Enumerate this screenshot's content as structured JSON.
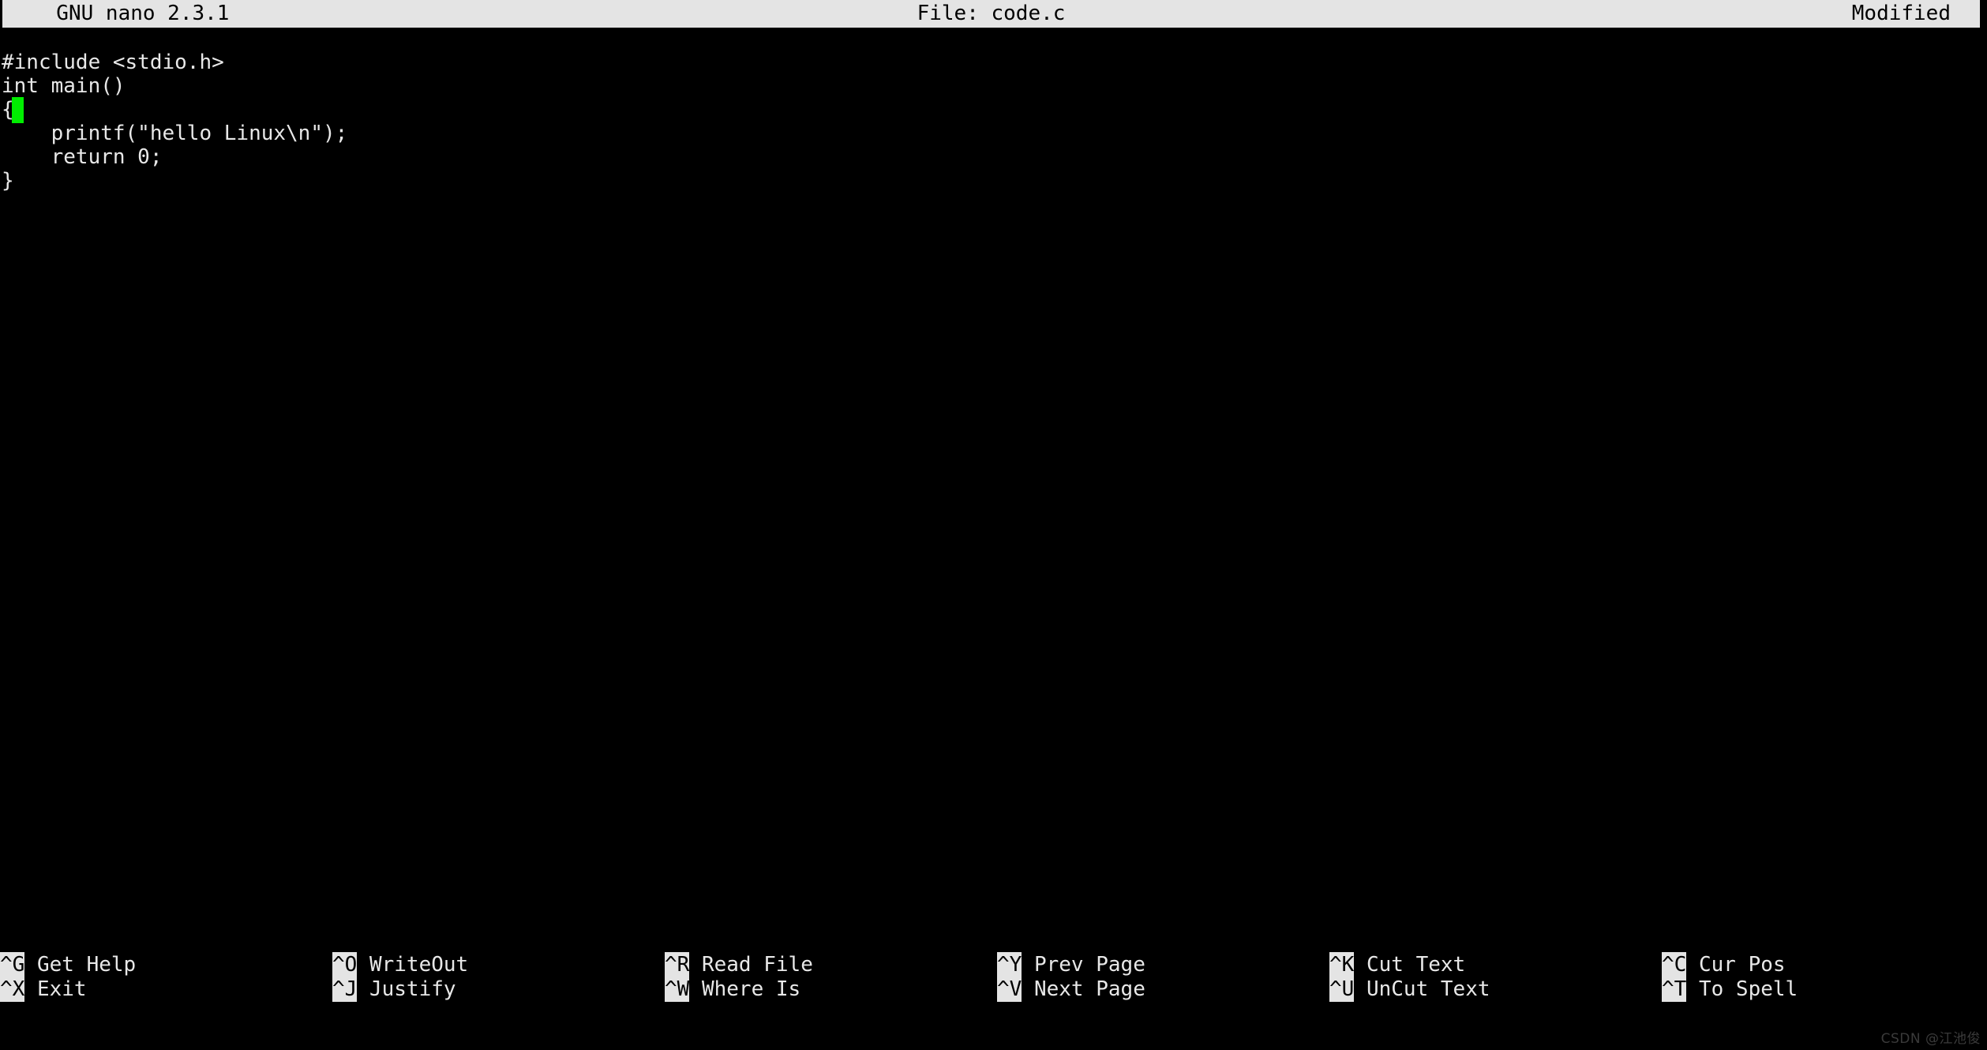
{
  "app": {
    "name": "GNU nano",
    "version": "2.3.1",
    "title_left": "  GNU nano 2.3.1",
    "title_center": "File: code.c",
    "title_right": "Modified",
    "filename": "code.c",
    "status": "Modified"
  },
  "colors": {
    "background": "#000000",
    "foreground": "#E8E8E8",
    "bar_background": "#E4E4E4",
    "bar_foreground": "#000000",
    "cursor": "#00EE00",
    "watermark": "#3A3A3A"
  },
  "editor": {
    "lines": [
      "#include <stdio.h>",
      "int main()",
      "{",
      "    printf(\"hello Linux\\n\");",
      "    return 0;",
      "}"
    ],
    "cursor": {
      "line": 3,
      "column": 2
    }
  },
  "helpbar": {
    "rows": [
      [
        {
          "key": "^G",
          "label": "Get Help"
        },
        {
          "key": "^O",
          "label": "WriteOut"
        },
        {
          "key": "^R",
          "label": "Read File"
        },
        {
          "key": "^Y",
          "label": "Prev Page"
        },
        {
          "key": "^K",
          "label": "Cut Text"
        },
        {
          "key": "^C",
          "label": "Cur Pos"
        }
      ],
      [
        {
          "key": "^X",
          "label": "Exit"
        },
        {
          "key": "^J",
          "label": "Justify"
        },
        {
          "key": "^W",
          "label": "Where Is"
        },
        {
          "key": "^V",
          "label": "Next Page"
        },
        {
          "key": "^U",
          "label": "UnCut Text"
        },
        {
          "key": "^T",
          "label": "To Spell"
        }
      ]
    ]
  },
  "watermark": {
    "text": "CSDN @江池俊"
  }
}
